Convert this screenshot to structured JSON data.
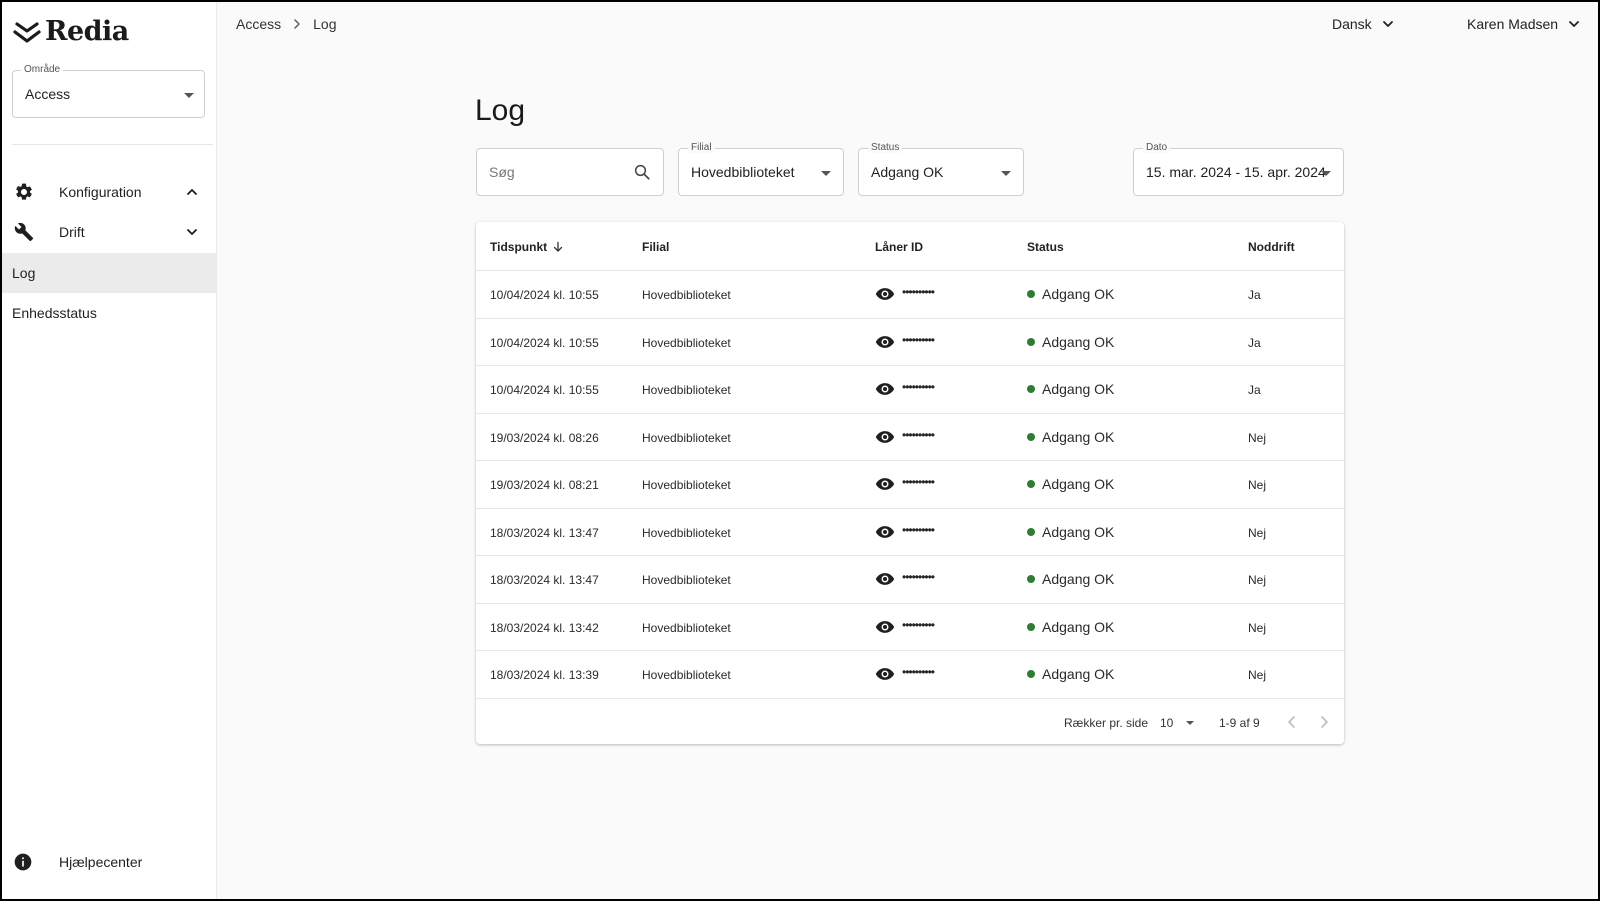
{
  "brand": {
    "name": "Redia"
  },
  "area": {
    "legend": "Område",
    "value": "Access"
  },
  "nav": {
    "konfiguration": "Konfiguration",
    "drift": "Drift",
    "log": "Log",
    "enhedsstatus": "Enhedsstatus",
    "help": "Hjælpecenter"
  },
  "breadcrumb": {
    "root": "Access",
    "current": "Log"
  },
  "topbar": {
    "language": "Dansk",
    "user": "Karen Madsen"
  },
  "page": {
    "title": "Log"
  },
  "filters": {
    "search_placeholder": "Søg",
    "filial_legend": "Filial",
    "filial_value": "Hovedbiblioteket",
    "status_legend": "Status",
    "status_value": "Adgang OK",
    "date_legend": "Dato",
    "date_value": "15. mar. 2024 - 15. apr. 2024"
  },
  "table": {
    "columns": {
      "time": "Tidspunkt",
      "branch": "Filial",
      "borrower": "Låner ID",
      "status": "Status",
      "emergency": "Noddrift"
    },
    "masked_id": "••••••••••",
    "status_color": "#2e7d32",
    "rows": [
      {
        "time": "10/04/2024 kl. 10:55",
        "branch": "Hovedbiblioteket",
        "status": "Adgang OK",
        "emergency": "Ja"
      },
      {
        "time": "10/04/2024 kl. 10:55",
        "branch": "Hovedbiblioteket",
        "status": "Adgang OK",
        "emergency": "Ja"
      },
      {
        "time": "10/04/2024 kl. 10:55",
        "branch": "Hovedbiblioteket",
        "status": "Adgang OK",
        "emergency": "Ja"
      },
      {
        "time": "19/03/2024 kl. 08:26",
        "branch": "Hovedbiblioteket",
        "status": "Adgang OK",
        "emergency": "Nej"
      },
      {
        "time": "19/03/2024 kl. 08:21",
        "branch": "Hovedbiblioteket",
        "status": "Adgang OK",
        "emergency": "Nej"
      },
      {
        "time": "18/03/2024 kl. 13:47",
        "branch": "Hovedbiblioteket",
        "status": "Adgang OK",
        "emergency": "Nej"
      },
      {
        "time": "18/03/2024 kl. 13:47",
        "branch": "Hovedbiblioteket",
        "status": "Adgang OK",
        "emergency": "Nej"
      },
      {
        "time": "18/03/2024 kl. 13:42",
        "branch": "Hovedbiblioteket",
        "status": "Adgang OK",
        "emergency": "Nej"
      },
      {
        "time": "18/03/2024 kl. 13:39",
        "branch": "Hovedbiblioteket",
        "status": "Adgang OK",
        "emergency": "Nej"
      }
    ]
  },
  "pagination": {
    "rows_label": "Rækker pr. side",
    "rows_value": "10",
    "range": "1-9 af 9"
  },
  "icons": {
    "logo": "redia-logo-icon",
    "konfiguration": "gear-icon",
    "drift": "wrench-icon",
    "help": "info-icon",
    "search": "search-icon",
    "row_action": "eye-icon",
    "sort": "arrow-down-icon"
  }
}
